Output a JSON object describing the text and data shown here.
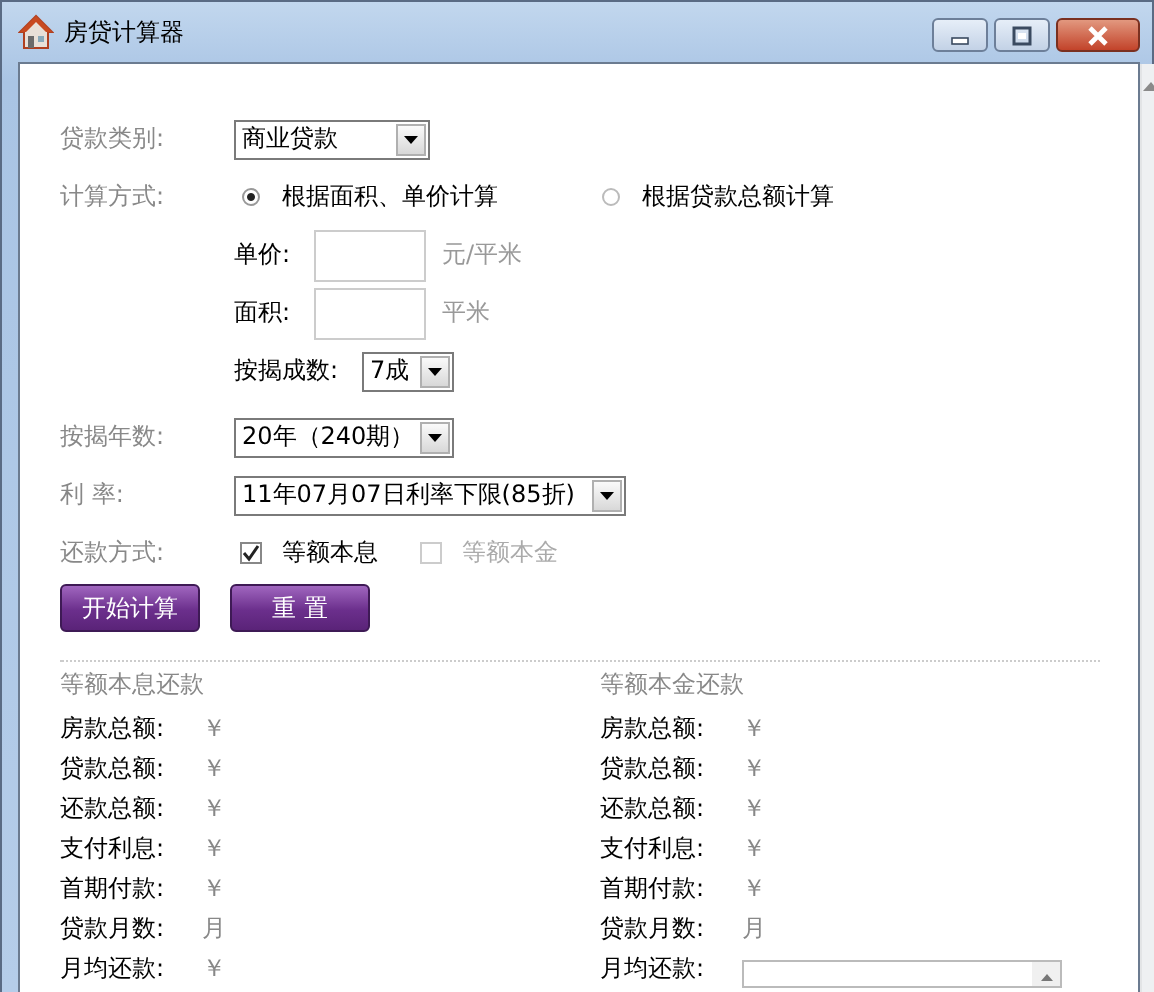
{
  "window": {
    "title": "房贷计算器"
  },
  "form": {
    "loan_type": {
      "label": "贷款类别:",
      "value": "商业贷款"
    },
    "method": {
      "label": "计算方式:",
      "options": [
        {
          "label": "根据面积、单价计算",
          "selected": true
        },
        {
          "label": "根据贷款总额计算",
          "selected": false
        }
      ]
    },
    "unit_price": {
      "label": "单价:",
      "unit": "元/平米"
    },
    "area": {
      "label": "面积:",
      "unit": "平米"
    },
    "down_payment": {
      "label": "按揭成数:",
      "value": "7成"
    },
    "years": {
      "label": "按揭年数:",
      "value": "20年（240期）"
    },
    "rate": {
      "label": "利 率:",
      "value": "11年07月07日利率下限(85折)"
    },
    "repayment": {
      "label": "还款方式:",
      "options": [
        {
          "label": "等额本息",
          "checked": true,
          "disabled": false
        },
        {
          "label": "等额本金",
          "checked": false,
          "disabled": true
        }
      ]
    },
    "buttons": [
      "开始计算",
      "重 置"
    ]
  },
  "results": [
    {
      "title": "等额本息还款",
      "rows": [
        {
          "kind": "text",
          "label": "房款总额:",
          "value": "￥"
        },
        {
          "kind": "text",
          "label": "贷款总额:",
          "value": "￥"
        },
        {
          "kind": "text",
          "label": "还款总额:",
          "value": "￥"
        },
        {
          "kind": "text",
          "label": "支付利息:",
          "value": "￥"
        },
        {
          "kind": "text",
          "label": "首期付款:",
          "value": "￥"
        },
        {
          "kind": "text",
          "label": "贷款月数:",
          "value": "月"
        },
        {
          "kind": "text",
          "label": "月均还款:",
          "value": "￥"
        }
      ]
    },
    {
      "title": "等额本金还款",
      "rows": [
        {
          "kind": "text",
          "label": "房款总额:",
          "value": "￥"
        },
        {
          "kind": "text",
          "label": "贷款总额:",
          "value": "￥"
        },
        {
          "kind": "text",
          "label": "还款总额:",
          "value": "￥"
        },
        {
          "kind": "text",
          "label": "支付利息:",
          "value": "￥"
        },
        {
          "kind": "text",
          "label": "首期付款:",
          "value": "￥"
        },
        {
          "kind": "text",
          "label": "贷款月数:",
          "value": "月"
        },
        {
          "kind": "textbox",
          "label": "月均还款:"
        }
      ]
    }
  ]
}
